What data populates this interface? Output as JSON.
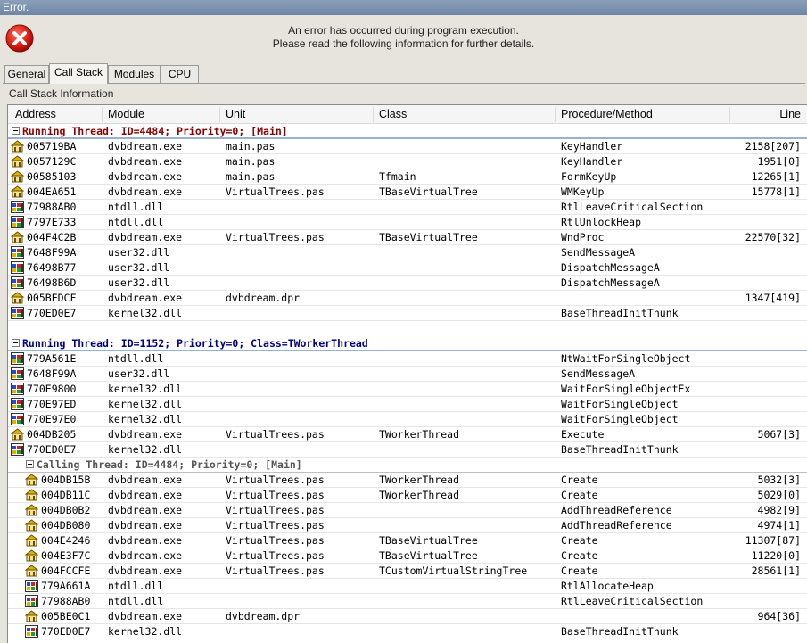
{
  "window": {
    "title": "Error."
  },
  "header": {
    "line1": "An error has occurred during program execution.",
    "line2": "Please read the following information for further details."
  },
  "tabs": [
    {
      "label": "General",
      "active": false
    },
    {
      "label": "Call Stack",
      "active": true
    },
    {
      "label": "Modules",
      "active": false
    },
    {
      "label": "CPU",
      "active": false
    }
  ],
  "section_title": "Call Stack Information",
  "columns": [
    "Address",
    "Module",
    "Unit",
    "Class",
    "Procedure/Method",
    "Line"
  ],
  "colors": {
    "thread_main": "#8b0000",
    "thread_worker": "#000080",
    "thread_calling": "#555555"
  },
  "groups": [
    {
      "title": "Running Thread: ID=4484; Priority=0; [Main]",
      "kind": "main",
      "rows": [
        {
          "icon": "unit-icon",
          "address": "005719BA",
          "module": "dvbdream.exe",
          "unit": "main.pas",
          "class": "",
          "proc": "KeyHandler",
          "line": "2158[207]"
        },
        {
          "icon": "unit-icon",
          "address": "0057129C",
          "module": "dvbdream.exe",
          "unit": "main.pas",
          "class": "",
          "proc": "KeyHandler",
          "line": "1951[0]"
        },
        {
          "icon": "unit-icon",
          "address": "00585103",
          "module": "dvbdream.exe",
          "unit": "main.pas",
          "class": "Tfmain",
          "proc": "FormKeyUp",
          "line": "12265[1]"
        },
        {
          "icon": "unit-icon",
          "address": "004EA651",
          "module": "dvbdream.exe",
          "unit": "VirtualTrees.pas",
          "class": "TBaseVirtualTree",
          "proc": "WMKeyUp",
          "line": "15778[1]"
        },
        {
          "icon": "dll-icon",
          "address": "77988AB0",
          "module": "ntdll.dll",
          "unit": "",
          "class": "",
          "proc": "RtlLeaveCriticalSection",
          "line": ""
        },
        {
          "icon": "dll-icon",
          "address": "7797E733",
          "module": "ntdll.dll",
          "unit": "",
          "class": "",
          "proc": "RtlUnlockHeap",
          "line": ""
        },
        {
          "icon": "unit-icon",
          "address": "004F4C2B",
          "module": "dvbdream.exe",
          "unit": "VirtualTrees.pas",
          "class": "TBaseVirtualTree",
          "proc": "WndProc",
          "line": "22570[32]"
        },
        {
          "icon": "dll-icon",
          "address": "7648F99A",
          "module": "user32.dll",
          "unit": "",
          "class": "",
          "proc": "SendMessageA",
          "line": ""
        },
        {
          "icon": "dll-icon",
          "address": "76498B77",
          "module": "user32.dll",
          "unit": "",
          "class": "",
          "proc": "DispatchMessageA",
          "line": ""
        },
        {
          "icon": "dll-icon",
          "address": "76498B6D",
          "module": "user32.dll",
          "unit": "",
          "class": "",
          "proc": "DispatchMessageA",
          "line": ""
        },
        {
          "icon": "unit-icon",
          "address": "005BEDCF",
          "module": "dvbdream.exe",
          "unit": "dvbdream.dpr",
          "class": "",
          "proc": "",
          "line": "1347[419]"
        },
        {
          "icon": "dll-icon",
          "address": "770ED0E7",
          "module": "kernel32.dll",
          "unit": "",
          "class": "",
          "proc": "BaseThreadInitThunk",
          "line": ""
        }
      ]
    },
    {
      "title": "Running Thread: ID=1152; Priority=0; Class=TWorkerThread",
      "kind": "worker",
      "rows": [
        {
          "icon": "dll-icon",
          "address": "779A561E",
          "module": "ntdll.dll",
          "unit": "",
          "class": "",
          "proc": "NtWaitForSingleObject",
          "line": ""
        },
        {
          "icon": "dll-icon",
          "address": "7648F99A",
          "module": "user32.dll",
          "unit": "",
          "class": "",
          "proc": "SendMessageA",
          "line": ""
        },
        {
          "icon": "dll-icon",
          "address": "770E9800",
          "module": "kernel32.dll",
          "unit": "",
          "class": "",
          "proc": "WaitForSingleObjectEx",
          "line": ""
        },
        {
          "icon": "dll-icon",
          "address": "770E97ED",
          "module": "kernel32.dll",
          "unit": "",
          "class": "",
          "proc": "WaitForSingleObject",
          "line": ""
        },
        {
          "icon": "dll-icon",
          "address": "770E97E0",
          "module": "kernel32.dll",
          "unit": "",
          "class": "",
          "proc": "WaitForSingleObject",
          "line": ""
        },
        {
          "icon": "unit-icon",
          "address": "004DB205",
          "module": "dvbdream.exe",
          "unit": "VirtualTrees.pas",
          "class": "TWorkerThread",
          "proc": "Execute",
          "line": "5067[3]"
        },
        {
          "icon": "dll-icon",
          "address": "770ED0E7",
          "module": "kernel32.dll",
          "unit": "",
          "class": "",
          "proc": "BaseThreadInitThunk",
          "line": ""
        }
      ]
    },
    {
      "title": "Calling Thread: ID=4484; Priority=0; [Main]",
      "kind": "calling",
      "rows": [
        {
          "icon": "unit-icon",
          "address": "004DB15B",
          "module": "dvbdream.exe",
          "unit": "VirtualTrees.pas",
          "class": "TWorkerThread",
          "proc": "Create",
          "line": "5032[3]"
        },
        {
          "icon": "unit-icon",
          "address": "004DB11C",
          "module": "dvbdream.exe",
          "unit": "VirtualTrees.pas",
          "class": "TWorkerThread",
          "proc": "Create",
          "line": "5029[0]"
        },
        {
          "icon": "unit-icon",
          "address": "004DB0B2",
          "module": "dvbdream.exe",
          "unit": "VirtualTrees.pas",
          "class": "",
          "proc": "AddThreadReference",
          "line": "4982[9]"
        },
        {
          "icon": "unit-icon",
          "address": "004DB080",
          "module": "dvbdream.exe",
          "unit": "VirtualTrees.pas",
          "class": "",
          "proc": "AddThreadReference",
          "line": "4974[1]"
        },
        {
          "icon": "unit-icon",
          "address": "004E4246",
          "module": "dvbdream.exe",
          "unit": "VirtualTrees.pas",
          "class": "TBaseVirtualTree",
          "proc": "Create",
          "line": "11307[87]"
        },
        {
          "icon": "unit-icon",
          "address": "004E3F7C",
          "module": "dvbdream.exe",
          "unit": "VirtualTrees.pas",
          "class": "TBaseVirtualTree",
          "proc": "Create",
          "line": "11220[0]"
        },
        {
          "icon": "unit-icon",
          "address": "004FCCFE",
          "module": "dvbdream.exe",
          "unit": "VirtualTrees.pas",
          "class": "TCustomVirtualStringTree",
          "proc": "Create",
          "line": "28561[1]"
        },
        {
          "icon": "dll-icon",
          "address": "779A661A",
          "module": "ntdll.dll",
          "unit": "",
          "class": "",
          "proc": "RtlAllocateHeap",
          "line": ""
        },
        {
          "icon": "dll-icon",
          "address": "77988AB0",
          "module": "ntdll.dll",
          "unit": "",
          "class": "",
          "proc": "RtlLeaveCriticalSection",
          "line": ""
        },
        {
          "icon": "unit-icon",
          "address": "005BE0C1",
          "module": "dvbdream.exe",
          "unit": "dvbdream.dpr",
          "class": "",
          "proc": "",
          "line": "964[36]"
        },
        {
          "icon": "dll-icon",
          "address": "770ED0E7",
          "module": "kernel32.dll",
          "unit": "",
          "class": "",
          "proc": "BaseThreadInitThunk",
          "line": ""
        }
      ]
    }
  ]
}
